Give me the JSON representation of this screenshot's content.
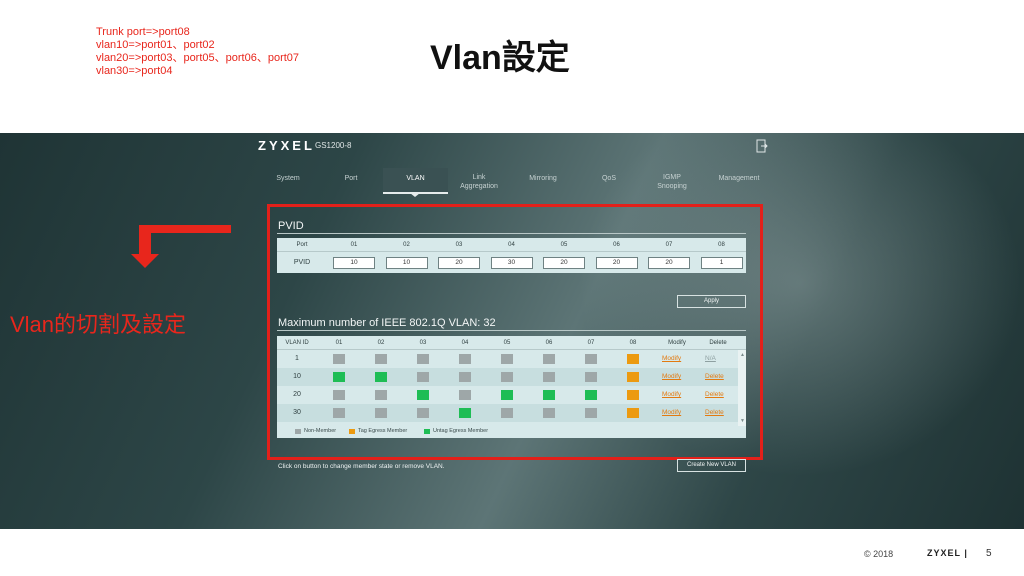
{
  "notes": [
    "Trunk port=>port08",
    "vlan10=>port01、port02",
    "vlan20=>port03、port05、port06、port07",
    "vlan30=>port04"
  ],
  "slide_title": "Vlan設定",
  "left_label": "Vlan的切割及設定",
  "app": {
    "brand": "ZYXEL",
    "model": "GS1200-8",
    "nav": [
      {
        "label": "System"
      },
      {
        "label": "Port"
      },
      {
        "label": "VLAN"
      },
      {
        "label": "Link Aggregation"
      },
      {
        "label": "Mirroring"
      },
      {
        "label": "QoS"
      },
      {
        "label": "IGMP Snooping"
      },
      {
        "label": "Management"
      }
    ]
  },
  "pvid": {
    "title": "PVID",
    "port_header": "Port",
    "row_label": "PVID",
    "ports": [
      "01",
      "02",
      "03",
      "04",
      "05",
      "06",
      "07",
      "08"
    ],
    "values": [
      "10",
      "10",
      "20",
      "30",
      "20",
      "20",
      "20",
      "1"
    ],
    "apply_label": "Apply"
  },
  "vlan": {
    "title": "Maximum number of IEEE 802.1Q VLAN: 32",
    "headers": {
      "id": "VLAN ID",
      "modify": "Modify",
      "delete": "Delete"
    },
    "ports": [
      "01",
      "02",
      "03",
      "04",
      "05",
      "06",
      "07",
      "08"
    ],
    "rows": [
      {
        "id": "1",
        "members": [
          "non",
          "non",
          "non",
          "non",
          "non",
          "non",
          "non",
          "tag"
        ],
        "modify": "Modify",
        "delete": "N/A"
      },
      {
        "id": "10",
        "members": [
          "untag",
          "untag",
          "non",
          "non",
          "non",
          "non",
          "non",
          "tag"
        ],
        "modify": "Modify",
        "delete": "Delete"
      },
      {
        "id": "20",
        "members": [
          "non",
          "non",
          "untag",
          "non",
          "untag",
          "untag",
          "untag",
          "tag"
        ],
        "modify": "Modify",
        "delete": "Delete"
      },
      {
        "id": "30",
        "members": [
          "non",
          "non",
          "non",
          "untag",
          "non",
          "non",
          "non",
          "tag"
        ],
        "modify": "Modify",
        "delete": "Delete"
      }
    ],
    "legend": {
      "non": "Non-Member",
      "tag": "Tag Egress Member",
      "untag": "Untag Egress Member"
    },
    "colors": {
      "non": "#9ea7a8",
      "tag": "#ec9a10",
      "untag": "#1ebd55"
    },
    "hint": "Click on button to change member state or remove VLAN.",
    "create_label": "Create New VLAN"
  },
  "footer": {
    "copyright": "© 2018",
    "brand": "ZYXEL |",
    "page": "5"
  }
}
